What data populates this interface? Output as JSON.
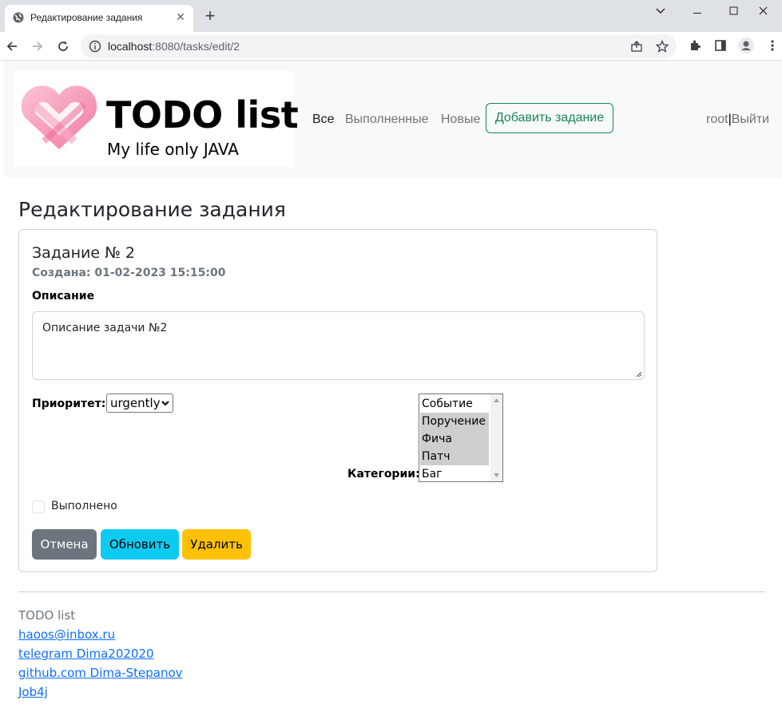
{
  "browser": {
    "tab_title": "Редактирование задания",
    "url_host": "localhost",
    "url_rest": ":8080/tasks/edit/2"
  },
  "header": {
    "logo_title": "TODO list",
    "logo_subtitle": "My life only JAVA",
    "nav": {
      "all": "Все",
      "done": "Выполненные",
      "new": "Новые"
    },
    "add_button": "Добавить задание",
    "user": "root",
    "user_separator": "|",
    "logout": "Выйти"
  },
  "page": {
    "title": "Редактирование задания"
  },
  "task": {
    "title": "Задание № 2",
    "created": "Создана: 01-02-2023 15:15:00",
    "description_label": "Описание",
    "description_value": "Описание задачи №2",
    "priority_label": "Приоритет:",
    "priority_value": "urgently",
    "categories_label": "Категории:",
    "categories": [
      {
        "label": "Событие",
        "selected": false
      },
      {
        "label": "Поручение",
        "selected": true
      },
      {
        "label": "Фича",
        "selected": true
      },
      {
        "label": "Патч",
        "selected": true
      },
      {
        "label": "Баг",
        "selected": false
      }
    ],
    "done_label": "Выполнено",
    "done_checked": false
  },
  "actions": {
    "cancel": "Отмена",
    "update": "Обновить",
    "delete": "Удалить"
  },
  "footer": {
    "title": "TODO list",
    "links": [
      "haoos@inbox.ru",
      "telegram Dima202020",
      "github.com Dima-Stepanov",
      "Job4j"
    ]
  },
  "colors": {
    "success": "#198754",
    "secondary": "#6c757d",
    "info": "#0dcaf0",
    "warning": "#ffc107",
    "link": "#0d6efd"
  }
}
